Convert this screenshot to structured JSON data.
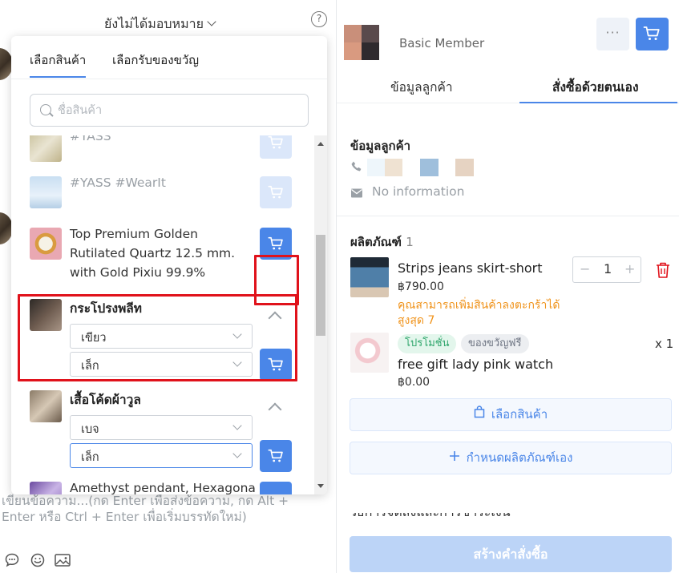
{
  "chat": {
    "assign_label": "ยังไม่ได้มอบหมาย",
    "help_label": "?",
    "composer_placeholder": "เขียนข้อความ...(กด Enter เพื่อส่งข้อความ, กด Alt + Enter หรือ Ctrl + Enter เพื่อเริ่มบรรทัดใหม่)"
  },
  "picker": {
    "tabs": [
      "เลือกสินค้า",
      "เลือกรับของขวัญ"
    ],
    "active_tab": 0,
    "search_placeholder": "ชื่อสินค้า",
    "items": [
      {
        "name": "#YASS",
        "cart_enabled": false
      },
      {
        "name": "#YASS #WearIt",
        "cart_enabled": false
      },
      {
        "name": "Top Premium Golden Rutilated Quartz 12.5 mm. with Gold Pixiu 99.9%",
        "cart_enabled": true,
        "highlighted": true
      },
      {
        "name": "กระโปรงพลีท",
        "expanded": true,
        "highlighted": true,
        "options": [
          "เขียว",
          "เล็ก"
        ],
        "cart_enabled": true
      },
      {
        "name": "เสื้อโค้ดผ้าวูล",
        "expanded": true,
        "options": [
          "เบจ",
          "เล็ก"
        ],
        "cart_enabled": true
      },
      {
        "name": "Amethyst pendant, Hexagona",
        "cart_enabled": true
      }
    ]
  },
  "customer": {
    "member_level": "Basic Member",
    "more_label": "···",
    "tabs": [
      "ข้อมูลลูกค้า",
      "สั่งซื้อด้วยตนเอง"
    ],
    "active_tab": 1,
    "info_title": "ข้อมูลลูกค้า",
    "email_value": "No information"
  },
  "order": {
    "products_title": "ผลิตภัณฑ์",
    "products_count": "1",
    "line_item": {
      "name": "Strips jeans skirt-short",
      "price": "฿790.00",
      "qty": "1",
      "qty_minus": "−",
      "qty_plus": "+",
      "warning": "คุณสามารถเพิ่มสินค้าลงตะกร้าได้สูงสุด 7"
    },
    "gift_item": {
      "tag_promo": "โปรโมชั่น",
      "tag_gift": "ของขวัญฟรี",
      "name": "free gift lady pink watch",
      "price": "฿0.00",
      "qty": "x 1"
    },
    "select_product_label": "เลือกสินค้า",
    "custom_product_label": "กำหนดผลิตภัณฑ์เอง",
    "cutoff_section_label": "วิธีการจัดส่งและการชำระเงิน",
    "create_order_label": "สร้างคำสั่งซื้อ"
  },
  "colors": {
    "accent": "#4a86e8",
    "highlight_box": "#e0121b",
    "warning": "#f0931b",
    "promo_tag_bg": "#e3f6ec",
    "promo_tag_fg": "#2ea66b",
    "gift_tag_bg": "#eceef1",
    "gift_tag_fg": "#6b7280"
  },
  "icons": {
    "help": "question-circle-icon",
    "cart": "shopping-cart-icon",
    "search": "search-icon",
    "phone": "phone-icon",
    "email": "mail-icon",
    "trash": "trash-icon",
    "bag": "shopping-bag-icon",
    "plus": "plus-icon",
    "emoji": "smiley-icon",
    "chat": "chat-bubble-icon",
    "image": "image-icon"
  }
}
